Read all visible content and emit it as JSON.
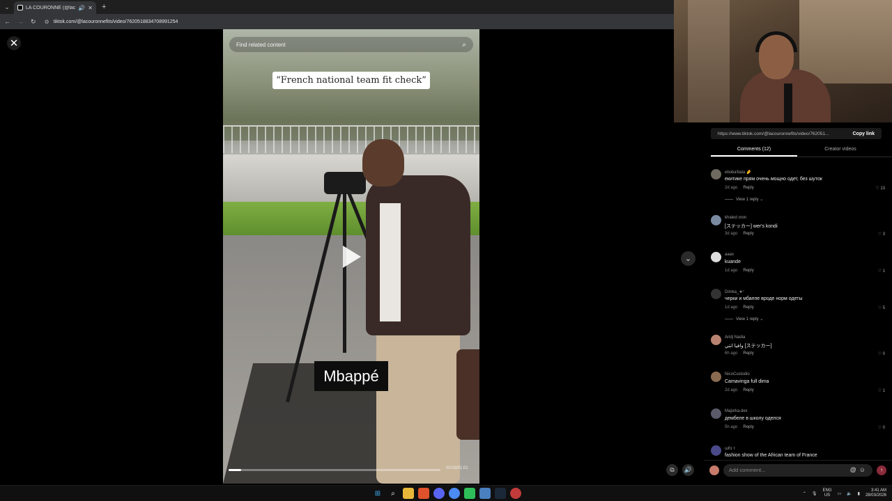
{
  "browser": {
    "tab_title": "LA COURONNE (@lacouronnefits) | TikTok",
    "url": "tiktok.com/@lacouronnefits/video/7620518834708991254"
  },
  "video": {
    "search_placeholder": "Find related content",
    "caption": "“French national team fit check”",
    "name_tag": "Mbappé",
    "time": "00:03/01:01",
    "progress": 0.06
  },
  "panel": {
    "share_url": "https://www.tiktok.com/@lacouronnefits/video/762051...",
    "copy_link": "Copy link",
    "tabs": [
      "Comments (12)",
      "Creator videos"
    ],
    "reply_label": "Reply",
    "view_reply_label": "View 1 reply",
    "add_comment_placeholder": "Add comment...",
    "comments": [
      {
        "user": "eboba'bala 🤌",
        "text": "екитике прям очень мощно одет, без шуток",
        "time": "2d ago",
        "likes": "13",
        "replies": true,
        "color": "#6f6a60"
      },
      {
        "user": "khaled oron",
        "text": "[ステッカー] wer's kondi",
        "time": "3d ago",
        "likes": "3",
        "replies": false,
        "color": "#7a8aa0"
      },
      {
        "user": "ааах",
        "text": "kuande",
        "time": "1d ago",
        "likes": "1",
        "replies": false,
        "color": "#dddddd"
      },
      {
        "user": "Dimka_★⁷",
        "text": "черки и мбаппе вроде норм одеты",
        "time": "1d ago",
        "likes": "5",
        "replies": true,
        "color": "#333333"
      },
      {
        "user": "Aridj Nadia",
        "text": "وافيا انتي [ステッカー]",
        "time": "6h ago",
        "likes": "0",
        "replies": false,
        "color": "#b98270"
      },
      {
        "user": "NicoCustodio",
        "text": "Camavinga full dima",
        "time": "2d ago",
        "likes": "1",
        "replies": false,
        "color": "#8a6a50"
      },
      {
        "user": "Majorka.dex",
        "text": "дембеле в школу оделся",
        "time": "5h ago",
        "likes": "0",
        "replies": false,
        "color": "#5a5a6a"
      },
      {
        "user": "ɯɦɪ ⚕",
        "text": "fashion show of the African team of France",
        "time": "",
        "likes": "",
        "replies": false,
        "color": "#4a4a8a"
      }
    ]
  },
  "taskbar": {
    "lang_top": "ENG",
    "lang_bottom": "US",
    "time": "3:41 AM",
    "date": "28/03/2026"
  }
}
